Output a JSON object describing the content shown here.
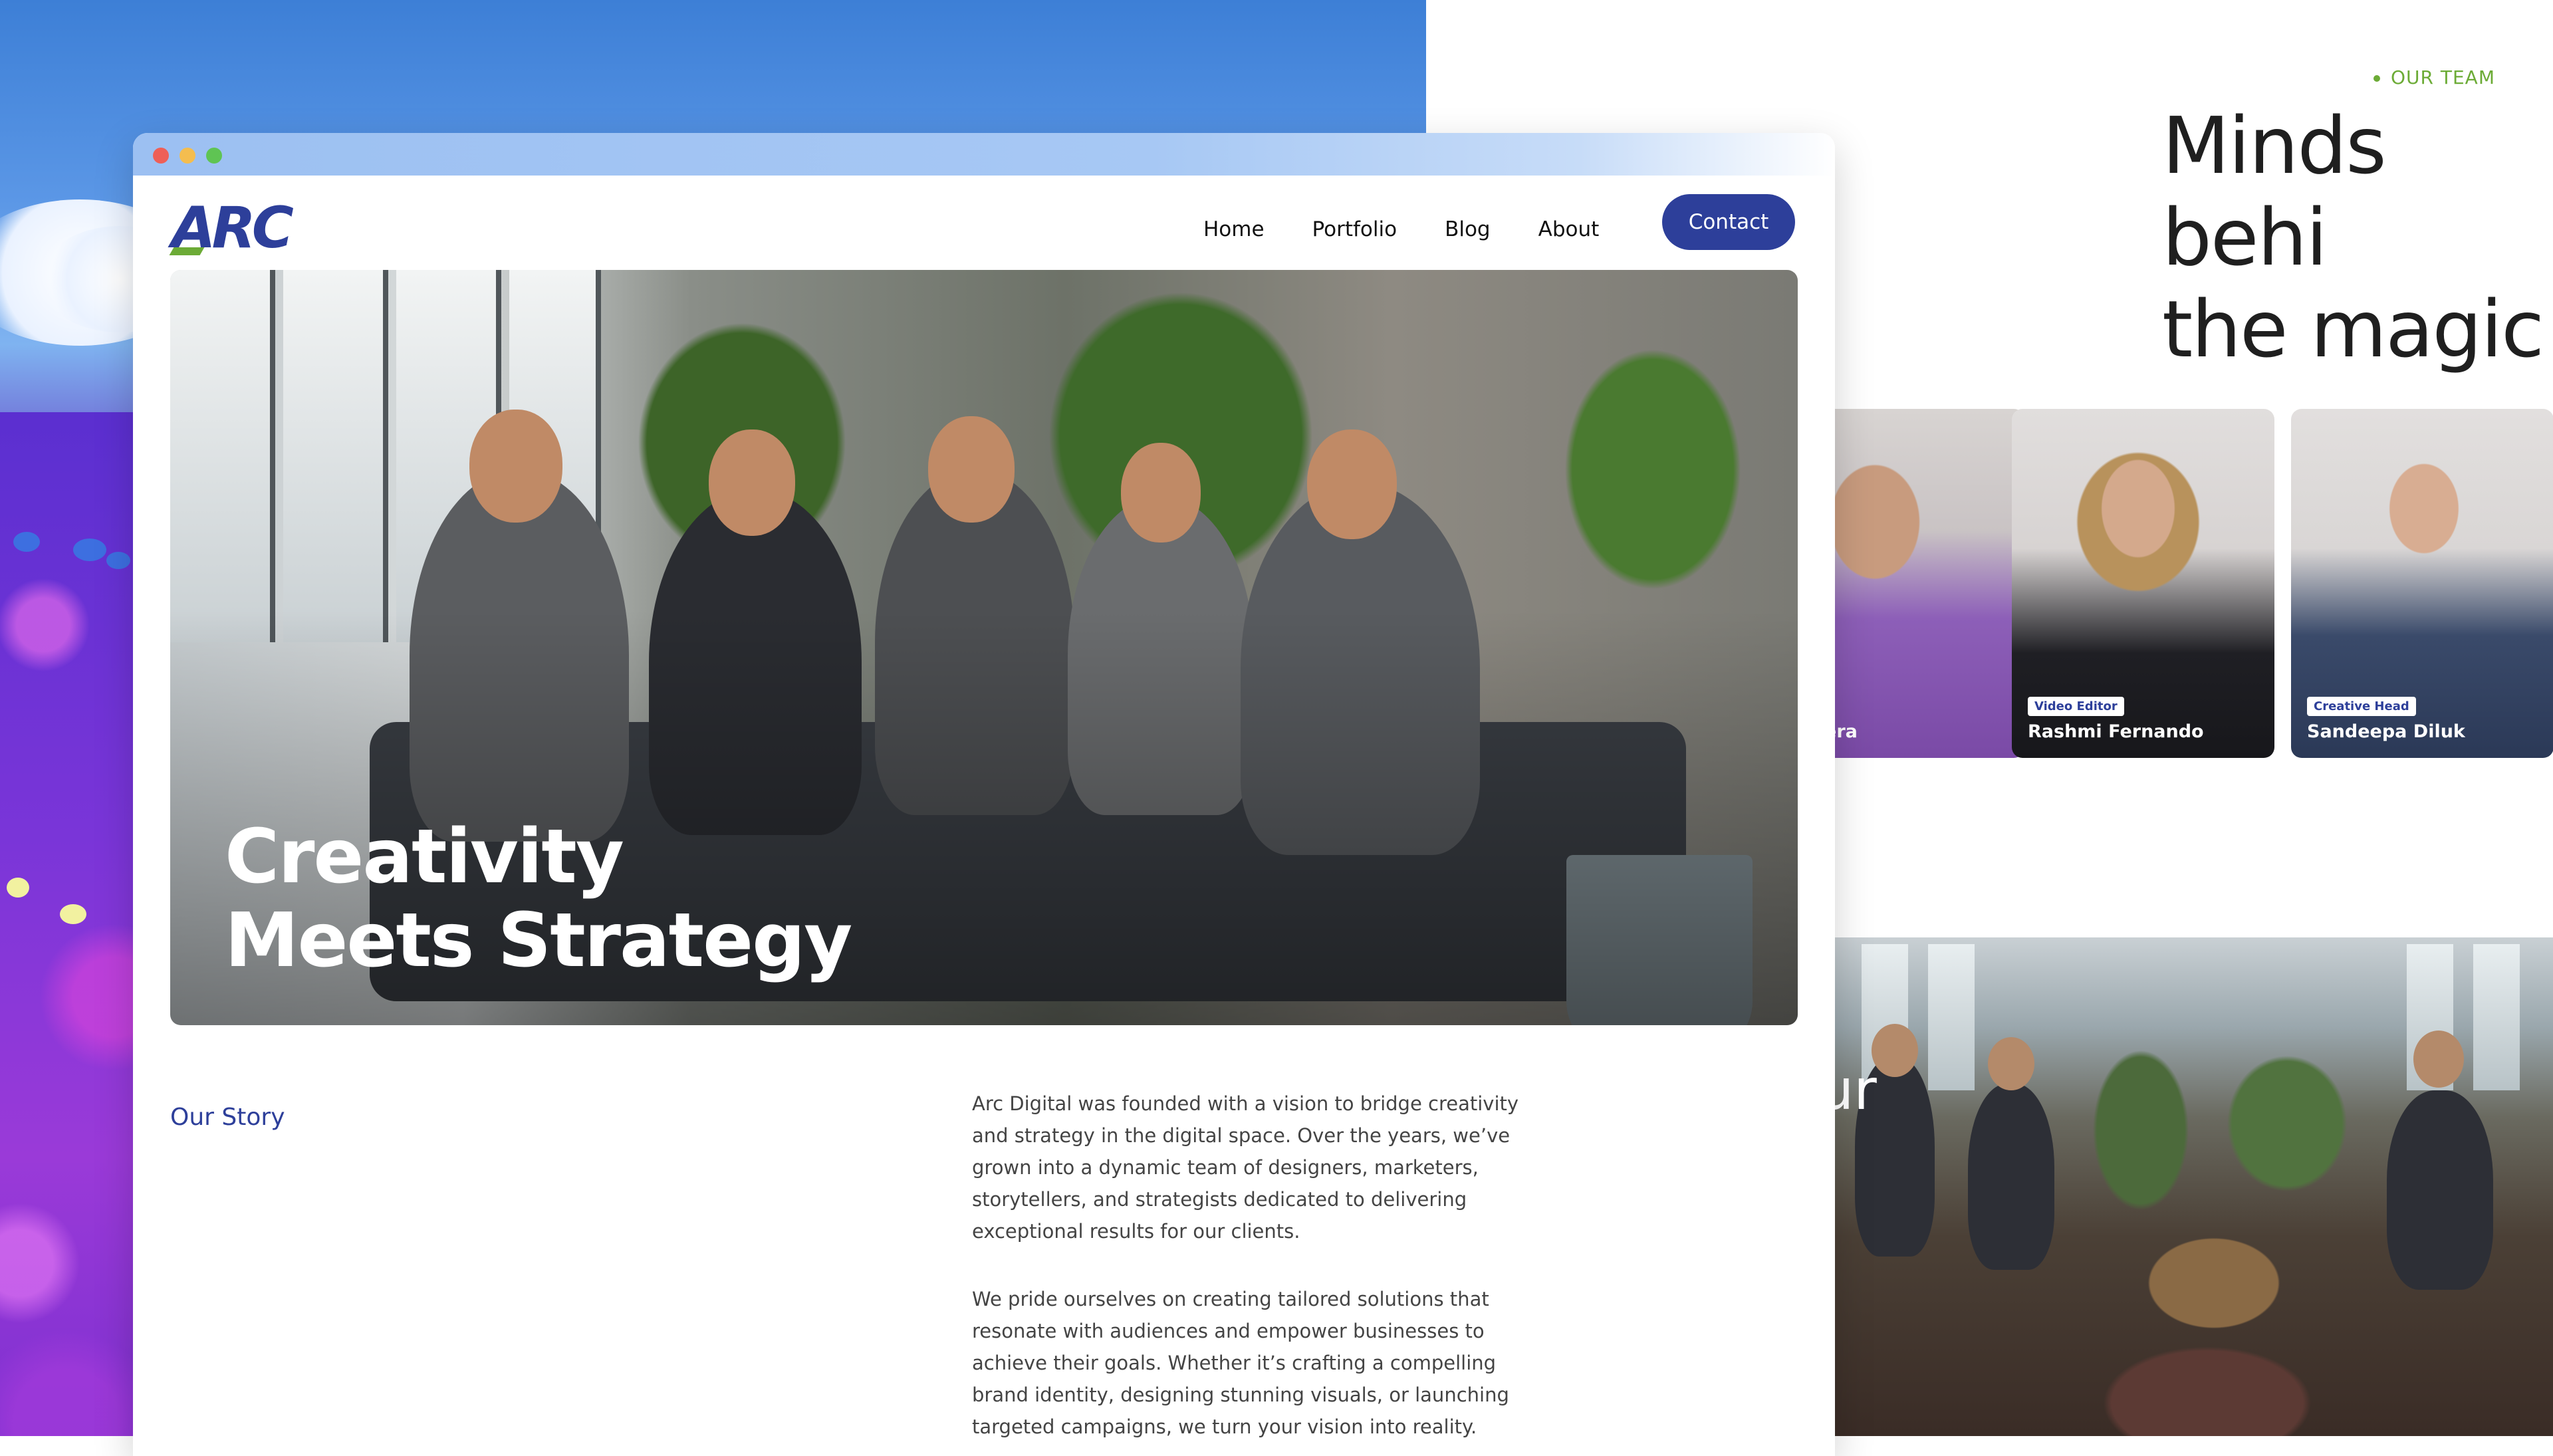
{
  "background_page": {
    "team_section": {
      "tag": "OUR TEAM",
      "heading": "Minds behi\nthe magic",
      "members": [
        {
          "name": "uraweera",
          "role": ""
        },
        {
          "name": "Rashmi Fernando",
          "role": "Video Editor"
        },
        {
          "name": "Sandeepa Diluk",
          "role": "Creative Head"
        }
      ]
    },
    "partial_heading": "ur"
  },
  "browser": {
    "header": {
      "logo": "ARC",
      "nav": [
        "Home",
        "Portfolio",
        "Blog",
        "About"
      ],
      "contact_label": "Contact"
    },
    "hero": {
      "title": "Creativity\nMeets Strategy"
    },
    "story": {
      "label": "Our Story",
      "paragraphs": [
        "Arc Digital was founded with a vision to bridge creativity and strategy in the digital space. Over the years, we’ve grown into a dynamic team of designers, marketers, storytellers, and strategists dedicated to delivering exceptional results for our clients.",
        "We pride ourselves on creating tailored solutions that resonate with audiences and empower businesses to achieve their goals. Whether it’s crafting a compelling brand identity, designing stunning visuals, or launching targeted campaigns, we turn your vision into reality."
      ]
    }
  },
  "colors": {
    "brand": "#2d3f9a",
    "accent_green": "#6cab36",
    "traffic_red": "#ee5f57",
    "traffic_yellow": "#f4bd4f",
    "traffic_green": "#5fc453"
  }
}
